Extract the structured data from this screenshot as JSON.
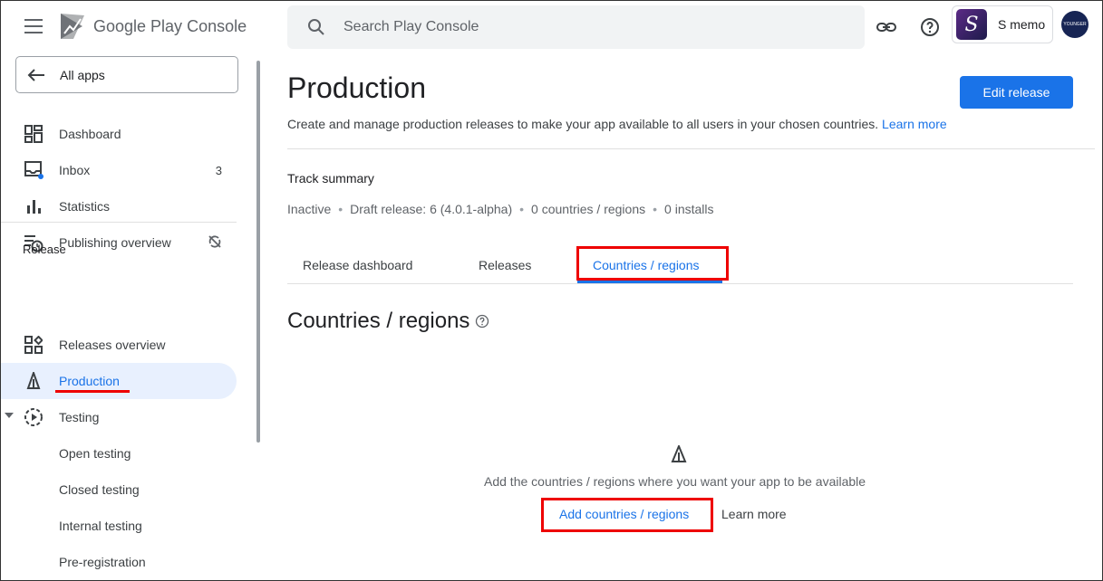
{
  "header": {
    "logo_google": "Google Play",
    "logo_console": "Console",
    "search_placeholder": "Search Play Console",
    "app_name": "S memo",
    "app_initial": "S",
    "avatar_text": "YOUNGER"
  },
  "sidebar": {
    "all_apps": "All apps",
    "items": [
      {
        "label": "Dashboard",
        "icon": "dashboard-icon"
      },
      {
        "label": "Inbox",
        "icon": "inbox-icon",
        "badge": "3"
      },
      {
        "label": "Statistics",
        "icon": "bar-chart-icon"
      },
      {
        "label": "Publishing overview",
        "icon": "publishing-icon"
      }
    ],
    "section_release": "Release",
    "release_items": [
      {
        "label": "Releases overview",
        "icon": "releases-overview-icon"
      },
      {
        "label": "Production",
        "icon": "rocket-icon",
        "active": true
      },
      {
        "label": "Testing",
        "icon": "testing-icon"
      }
    ],
    "testing_sub": [
      "Open testing",
      "Closed testing",
      "Internal testing",
      "Pre-registration"
    ]
  },
  "main": {
    "title": "Production",
    "edit_release": "Edit release",
    "description": "Create and manage production releases to make your app available to all users in your chosen countries.",
    "learn_more": "Learn more",
    "track_summary": "Track summary",
    "track_meta": [
      "Inactive",
      "Draft release: 6 (4.0.1-alpha)",
      "0 countries / regions",
      "0 installs"
    ],
    "tabs": [
      "Release dashboard",
      "Releases",
      "Countries / regions"
    ],
    "section_title": "Countries / regions",
    "empty_text": "Add the countries / regions where you want your app to be available",
    "add_link": "Add countries / regions",
    "learn_more_2": "Learn more"
  },
  "colors": {
    "accent": "#1a73e8",
    "highlight": "#ee0000"
  }
}
